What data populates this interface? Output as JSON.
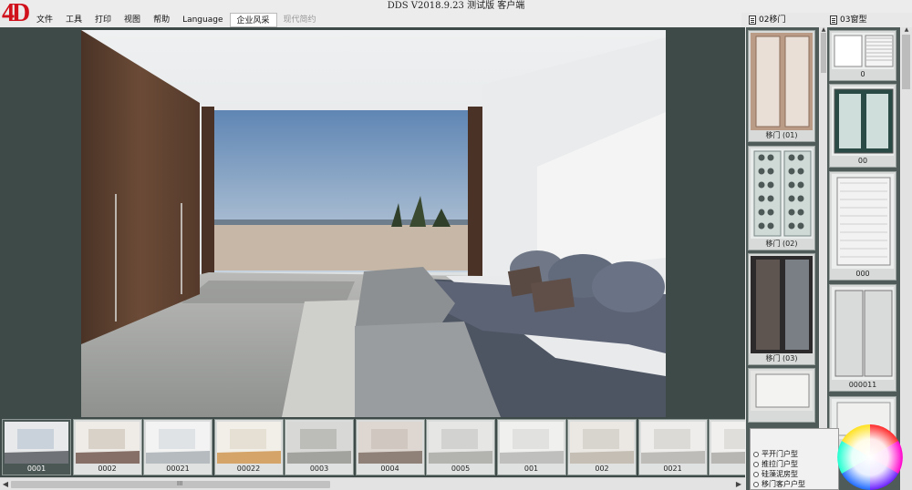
{
  "window": {
    "title": "DDS V2018.9.23 测试版 客户端",
    "logo_text": "4D"
  },
  "menu": {
    "items": [
      {
        "label": "文件",
        "state": "normal"
      },
      {
        "label": "工具",
        "state": "normal"
      },
      {
        "label": "打印",
        "state": "normal"
      },
      {
        "label": "视图",
        "state": "normal"
      },
      {
        "label": "帮助",
        "state": "normal"
      },
      {
        "label": "Language",
        "state": "normal"
      },
      {
        "label": "企业风采",
        "state": "active"
      },
      {
        "label": "现代简约",
        "state": "disabled"
      }
    ]
  },
  "panels": {
    "left_header": "02移门",
    "right_header": "03窗型"
  },
  "preview": {
    "icon": "bedroom-render"
  },
  "scene_thumbs": [
    {
      "label": "0001",
      "selected": true
    },
    {
      "label": "0002"
    },
    {
      "label": "00021"
    },
    {
      "label": "00022"
    },
    {
      "label": "0003"
    },
    {
      "label": "0004"
    },
    {
      "label": "0005"
    },
    {
      "label": "001"
    },
    {
      "label": "002"
    },
    {
      "label": "0021"
    },
    {
      "label": ""
    }
  ],
  "sliding_doors": [
    {
      "label": "移门 (01)"
    },
    {
      "label": "移门 (02)"
    },
    {
      "label": "移门 (03)"
    },
    {
      "label": ""
    }
  ],
  "windows": [
    {
      "label": "0"
    },
    {
      "label": "00"
    },
    {
      "label": "000"
    },
    {
      "label": "000011"
    },
    {
      "label": ""
    }
  ],
  "popup": {
    "items": [
      "平开门户型",
      "推拉门户型",
      "硅藻泥房型",
      "移门客户户型"
    ]
  },
  "scrollbar": {
    "grip": "III"
  },
  "colors": {
    "logo": "#d0111b",
    "stage_bg": "#3e4a47",
    "panel_bg": "#4f5b58"
  }
}
